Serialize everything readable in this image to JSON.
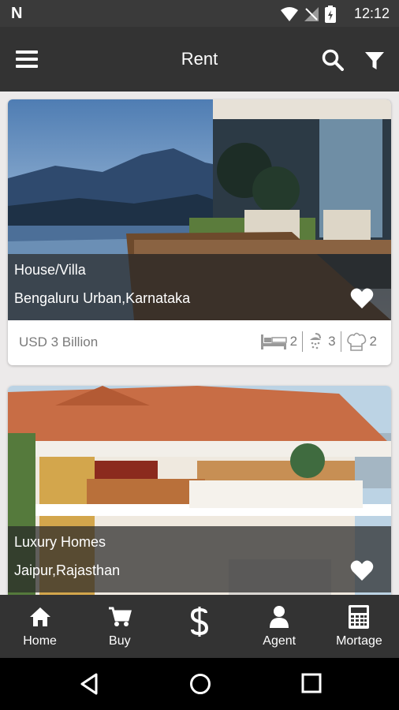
{
  "status_bar": {
    "time": "12:12",
    "notification_icon": "N"
  },
  "app_bar": {
    "title": "Rent"
  },
  "listings": [
    {
      "type": "House/Villa",
      "location": "Bengaluru Urban,Karnataka",
      "price": "USD 3 Billion",
      "beds": "2",
      "baths": "3",
      "kitchens": "2"
    },
    {
      "type": "Luxury Homes",
      "location": "Jaipur,Rajasthan"
    }
  ],
  "bottom_nav": [
    {
      "label": "Home",
      "icon": "home-icon"
    },
    {
      "label": "Buy",
      "icon": "cart-icon"
    },
    {
      "label": "",
      "icon": "dollar-icon"
    },
    {
      "label": "Agent",
      "icon": "person-icon"
    },
    {
      "label": "Mortage",
      "icon": "calculator-icon"
    }
  ],
  "colors": {
    "bar": "#333333",
    "status": "#3a3a3a",
    "background": "#eceaea"
  }
}
